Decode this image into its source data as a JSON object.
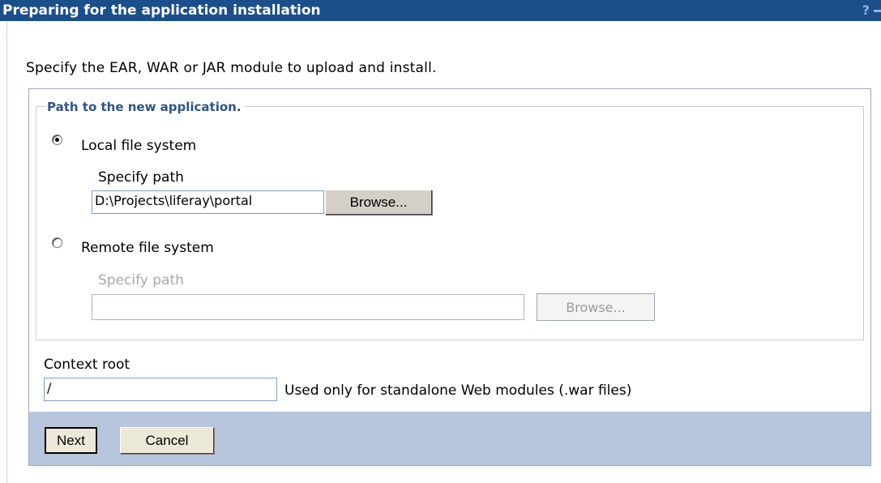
{
  "window": {
    "title": "Preparing for the application installation",
    "help_glyph": "?"
  },
  "intro_text": "Specify the EAR, WAR or JAR module to upload and install.",
  "path_group": {
    "legend": "Path to the new application.",
    "local": {
      "label": "Local file system",
      "selected": true,
      "path_label": "Specify path",
      "path_value": "D:\\Projects\\liferay\\portal",
      "browse_label": "Browse..."
    },
    "remote": {
      "label": "Remote file system",
      "selected": false,
      "path_label": "Specify path",
      "path_value": "",
      "browse_label": "Browse..."
    }
  },
  "context_root": {
    "label": "Context root",
    "value": "/",
    "hint": "Used only for standalone Web modules (.war files)"
  },
  "actions": {
    "next_label": "Next",
    "cancel_label": "Cancel"
  }
}
